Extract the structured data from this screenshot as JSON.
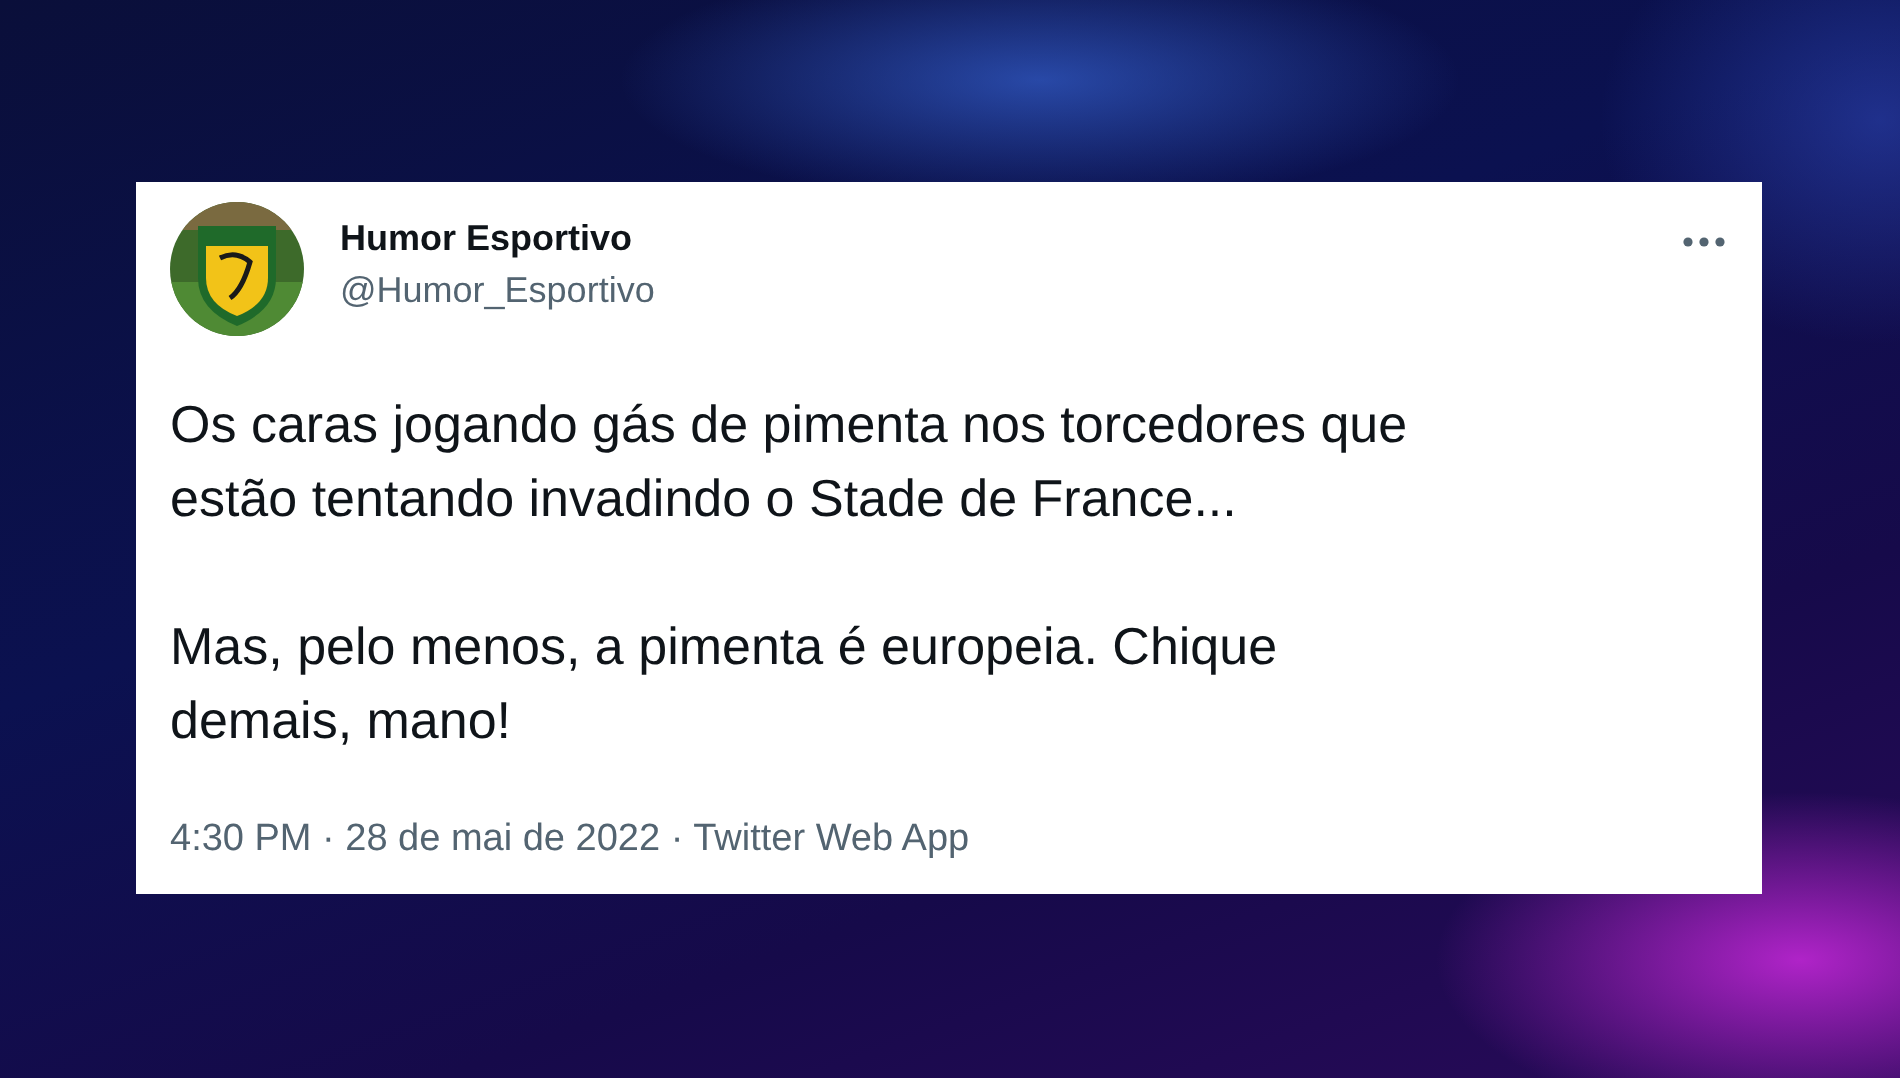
{
  "tweet": {
    "author": {
      "name": "Humor Esportivo",
      "handle": "@Humor_Esportivo"
    },
    "paragraphs": [
      "Os caras jogando gás de pimenta nos torcedores que\nestão tentando invadindo o Stade de France...",
      "Mas, pelo menos, a pimenta é europeia. Chique\ndemais, mano!"
    ],
    "meta": "4:30 PM · 28 de mai de 2022 · Twitter Web App"
  }
}
